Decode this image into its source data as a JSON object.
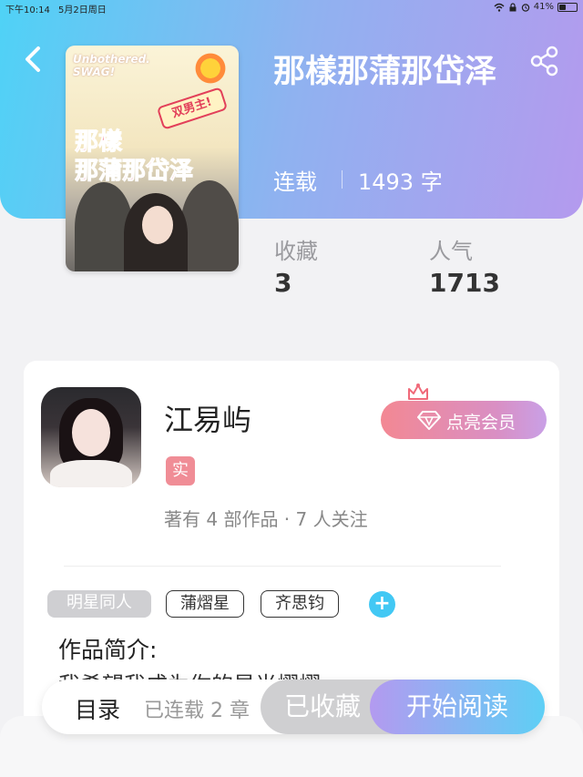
{
  "status_bar": {
    "time": "下午10:14",
    "date": "5月2日周日",
    "battery": "41%",
    "battery_level": 0.41
  },
  "header": {
    "back_icon": "chevron-left-icon",
    "share_icon": "share-icon"
  },
  "cover": {
    "top_text_1": "Unbothered.",
    "top_text_2": "SWAG!",
    "badge_text": "双男主!",
    "title_line_1": "那樣",
    "title_line_2": "那蒲那岱泽"
  },
  "book": {
    "title": "那樣那蒲那岱泽",
    "status": "连载",
    "word_count": "1493 字"
  },
  "stats": {
    "favorites_label": "收藏",
    "favorites_value": "3",
    "popularity_label": "人气",
    "popularity_value": "1713"
  },
  "author": {
    "name": "江易屿",
    "verified_badge": "实",
    "meta": "著有 4 部作品 · 7 人关注",
    "vip_button": "点亮会员"
  },
  "tags": {
    "category": "明星同人",
    "items": [
      "蒲熠星",
      "齐思钧"
    ],
    "add_icon": "plus-icon"
  },
  "intro": {
    "title": "作品简介:",
    "text": "我希望我成为你的星光熠熠"
  },
  "bottom_bar": {
    "toc_label": "目录",
    "toc_count": "已连载 2 章",
    "collected_button": "已收藏",
    "read_button": "开始阅读"
  },
  "colors": {
    "header_gradient_start": "#4fd2f6",
    "header_gradient_end": "#b49aee",
    "vip_pink": "#f38893",
    "add_blue": "#42c8f4"
  }
}
